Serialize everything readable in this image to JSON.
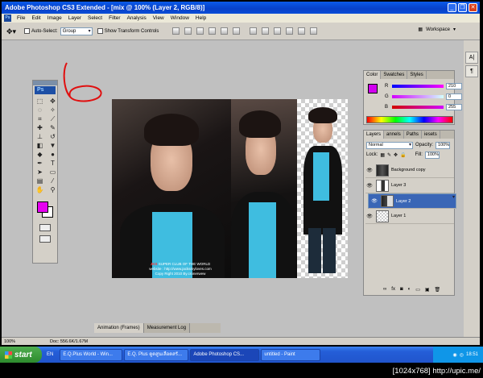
{
  "window": {
    "title": "Adobe Photoshop CS3 Extended - [mix @ 100% (Layer 2, RGB/8)]",
    "controls": [
      "minimize",
      "restore",
      "close"
    ]
  },
  "menubar": {
    "app_badge": "Ps",
    "items": [
      "File",
      "Edit",
      "Image",
      "Layer",
      "Select",
      "Filter",
      "Analysis",
      "View",
      "Window",
      "Help"
    ]
  },
  "options_bar": {
    "auto_select_label": "Auto-Select:",
    "auto_select_value": "Group",
    "show_transform_label": "Show Transform Controls",
    "workspace_label": "Workspace"
  },
  "dock": {
    "btn1": "A|",
    "btn2": "¶"
  },
  "toolbox": {
    "badge": "Ps",
    "fg_color": "#e600f0",
    "bg_color": "#ffffff"
  },
  "document": {
    "caption_title_red": "JKS",
    "caption_title": " SUPER CLUB OF THE WORLD",
    "caption_site": "website : http://www.jacksmyloves.com",
    "caption_copy": "Copy Right 2010 By.cronerwew"
  },
  "color_panel": {
    "tabs": [
      "Color",
      "Swatches",
      "Styles"
    ],
    "r_label": "R",
    "r_value": "210",
    "g_label": "G",
    "g_value": "0",
    "b_label": "B",
    "b_value": "255",
    "swatch_color": "#d200ff"
  },
  "layers_panel": {
    "tabs": [
      "Layers",
      "annels",
      "Paths",
      "iesets"
    ],
    "blend_mode": "Normal",
    "opacity_label": "Opacity:",
    "opacity_value": "100%",
    "lock_label": "Lock:",
    "fill_label": "Fill:",
    "fill_value": "100%",
    "layers": [
      {
        "name": "Background copy",
        "selected": false
      },
      {
        "name": "Layer 3",
        "selected": false
      },
      {
        "name": "Layer 2",
        "selected": true
      },
      {
        "name": "Layer 1",
        "selected": false
      }
    ]
  },
  "animation_tabs": [
    "Animation (Frames)",
    "Measurement Log"
  ],
  "status_bar": {
    "zoom": "100%",
    "doc": "Doc: 556.6K/1.67M"
  },
  "taskbar": {
    "start": "start",
    "lang": "EN",
    "tasks": [
      "E.Q.Plus World - Win...",
      "E.Q. Plus ดูดสูนเลือดสรั...",
      "Adobe Photoshop CS...",
      "untitled - Paint"
    ],
    "time": "18:51"
  },
  "watermark": "[1024x768] http://upic.me/"
}
